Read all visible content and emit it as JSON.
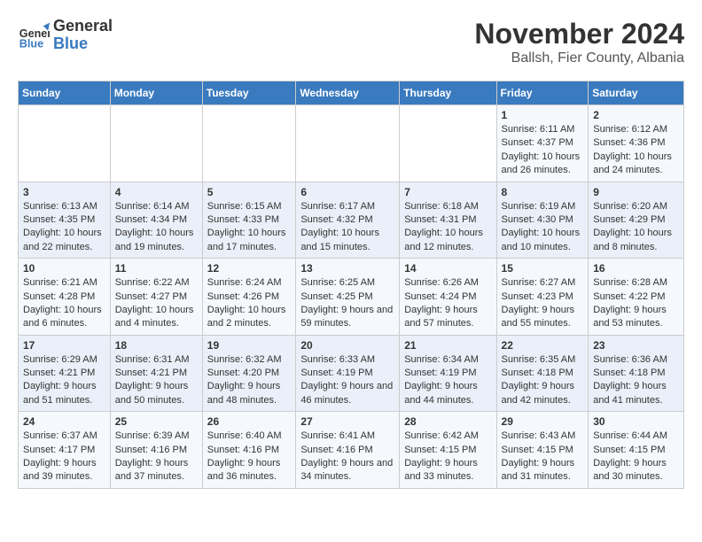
{
  "logo": {
    "line1": "General",
    "line2": "Blue"
  },
  "title": "November 2024",
  "location": "Ballsh, Fier County, Albania",
  "days_of_week": [
    "Sunday",
    "Monday",
    "Tuesday",
    "Wednesday",
    "Thursday",
    "Friday",
    "Saturday"
  ],
  "weeks": [
    [
      {
        "day": "",
        "content": ""
      },
      {
        "day": "",
        "content": ""
      },
      {
        "day": "",
        "content": ""
      },
      {
        "day": "",
        "content": ""
      },
      {
        "day": "",
        "content": ""
      },
      {
        "day": "1",
        "content": "Sunrise: 6:11 AM\nSunset: 4:37 PM\nDaylight: 10 hours and 26 minutes."
      },
      {
        "day": "2",
        "content": "Sunrise: 6:12 AM\nSunset: 4:36 PM\nDaylight: 10 hours and 24 minutes."
      }
    ],
    [
      {
        "day": "3",
        "content": "Sunrise: 6:13 AM\nSunset: 4:35 PM\nDaylight: 10 hours and 22 minutes."
      },
      {
        "day": "4",
        "content": "Sunrise: 6:14 AM\nSunset: 4:34 PM\nDaylight: 10 hours and 19 minutes."
      },
      {
        "day": "5",
        "content": "Sunrise: 6:15 AM\nSunset: 4:33 PM\nDaylight: 10 hours and 17 minutes."
      },
      {
        "day": "6",
        "content": "Sunrise: 6:17 AM\nSunset: 4:32 PM\nDaylight: 10 hours and 15 minutes."
      },
      {
        "day": "7",
        "content": "Sunrise: 6:18 AM\nSunset: 4:31 PM\nDaylight: 10 hours and 12 minutes."
      },
      {
        "day": "8",
        "content": "Sunrise: 6:19 AM\nSunset: 4:30 PM\nDaylight: 10 hours and 10 minutes."
      },
      {
        "day": "9",
        "content": "Sunrise: 6:20 AM\nSunset: 4:29 PM\nDaylight: 10 hours and 8 minutes."
      }
    ],
    [
      {
        "day": "10",
        "content": "Sunrise: 6:21 AM\nSunset: 4:28 PM\nDaylight: 10 hours and 6 minutes."
      },
      {
        "day": "11",
        "content": "Sunrise: 6:22 AM\nSunset: 4:27 PM\nDaylight: 10 hours and 4 minutes."
      },
      {
        "day": "12",
        "content": "Sunrise: 6:24 AM\nSunset: 4:26 PM\nDaylight: 10 hours and 2 minutes."
      },
      {
        "day": "13",
        "content": "Sunrise: 6:25 AM\nSunset: 4:25 PM\nDaylight: 9 hours and 59 minutes."
      },
      {
        "day": "14",
        "content": "Sunrise: 6:26 AM\nSunset: 4:24 PM\nDaylight: 9 hours and 57 minutes."
      },
      {
        "day": "15",
        "content": "Sunrise: 6:27 AM\nSunset: 4:23 PM\nDaylight: 9 hours and 55 minutes."
      },
      {
        "day": "16",
        "content": "Sunrise: 6:28 AM\nSunset: 4:22 PM\nDaylight: 9 hours and 53 minutes."
      }
    ],
    [
      {
        "day": "17",
        "content": "Sunrise: 6:29 AM\nSunset: 4:21 PM\nDaylight: 9 hours and 51 minutes."
      },
      {
        "day": "18",
        "content": "Sunrise: 6:31 AM\nSunset: 4:21 PM\nDaylight: 9 hours and 50 minutes."
      },
      {
        "day": "19",
        "content": "Sunrise: 6:32 AM\nSunset: 4:20 PM\nDaylight: 9 hours and 48 minutes."
      },
      {
        "day": "20",
        "content": "Sunrise: 6:33 AM\nSunset: 4:19 PM\nDaylight: 9 hours and 46 minutes."
      },
      {
        "day": "21",
        "content": "Sunrise: 6:34 AM\nSunset: 4:19 PM\nDaylight: 9 hours and 44 minutes."
      },
      {
        "day": "22",
        "content": "Sunrise: 6:35 AM\nSunset: 4:18 PM\nDaylight: 9 hours and 42 minutes."
      },
      {
        "day": "23",
        "content": "Sunrise: 6:36 AM\nSunset: 4:18 PM\nDaylight: 9 hours and 41 minutes."
      }
    ],
    [
      {
        "day": "24",
        "content": "Sunrise: 6:37 AM\nSunset: 4:17 PM\nDaylight: 9 hours and 39 minutes."
      },
      {
        "day": "25",
        "content": "Sunrise: 6:39 AM\nSunset: 4:16 PM\nDaylight: 9 hours and 37 minutes."
      },
      {
        "day": "26",
        "content": "Sunrise: 6:40 AM\nSunset: 4:16 PM\nDaylight: 9 hours and 36 minutes."
      },
      {
        "day": "27",
        "content": "Sunrise: 6:41 AM\nSunset: 4:16 PM\nDaylight: 9 hours and 34 minutes."
      },
      {
        "day": "28",
        "content": "Sunrise: 6:42 AM\nSunset: 4:15 PM\nDaylight: 9 hours and 33 minutes."
      },
      {
        "day": "29",
        "content": "Sunrise: 6:43 AM\nSunset: 4:15 PM\nDaylight: 9 hours and 31 minutes."
      },
      {
        "day": "30",
        "content": "Sunrise: 6:44 AM\nSunset: 4:15 PM\nDaylight: 9 hours and 30 minutes."
      }
    ]
  ]
}
